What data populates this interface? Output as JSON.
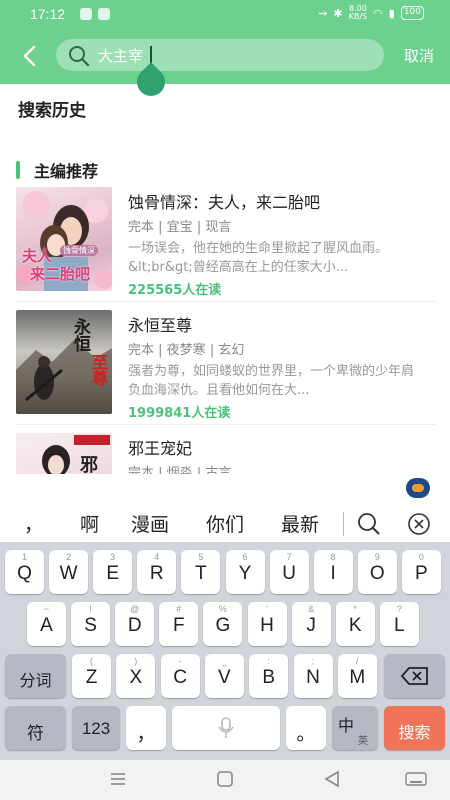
{
  "status": {
    "time": "17:12",
    "speed_top": "8.00",
    "speed_bottom": "KB/S",
    "battery": "100"
  },
  "search": {
    "value": "大主宰",
    "cancel": "取消"
  },
  "history_title": "搜索历史",
  "section_title": "主编推荐",
  "books": [
    {
      "title": "蚀骨情深：夫人，来二胎吧",
      "status": "完本",
      "author": "宜宝",
      "genre": "现言",
      "desc": "一场误会，他在她的生命里掀起了腥风血雨。&lt;br&gt;曾经高高在上的任家大小...",
      "reads": "225565人在读",
      "cover_main": "夫人",
      "cover_sub": "来二胎吧",
      "cover_tag": "蚀骨情深"
    },
    {
      "title": "永恒至尊",
      "status": "完本",
      "author": "夜梦寒",
      "genre": "玄幻",
      "desc": "强者为尊，如同蝼蚁的世界里，一个卑微的少年肩负血海深仇。且看他如何在大...",
      "reads": "1999841人在读",
      "cover_main": "永恒",
      "cover_sub": "至尊"
    },
    {
      "title": "邪王宠妃",
      "status": "完本",
      "author": "烟淼",
      "genre": "古言",
      "cover_main": "邪"
    }
  ],
  "candidates": [
    "，",
    "啊",
    "漫画",
    "你们",
    "最新"
  ],
  "keyboard": {
    "row1": [
      "Q",
      "W",
      "E",
      "R",
      "T",
      "Y",
      "U",
      "I",
      "O",
      "P"
    ],
    "row1_hints": [
      "1",
      "2",
      "3",
      "4",
      "5",
      "6",
      "7",
      "8",
      "9",
      "0"
    ],
    "row2": [
      "A",
      "S",
      "D",
      "F",
      "G",
      "H",
      "J",
      "K",
      "L"
    ],
    "row2_hints": [
      "~",
      "!",
      "@",
      "#",
      "%",
      "'",
      "&",
      "*",
      "?"
    ],
    "row3": [
      "Z",
      "X",
      "C",
      "V",
      "B",
      "N",
      "M"
    ],
    "row3_hints": [
      "(",
      ")",
      "-",
      "_",
      ":",
      ";",
      "/"
    ],
    "fenci": "分词",
    "fu": "符",
    "num": "123",
    "comma": "，",
    "period": "。",
    "zh": "中",
    "en": "英",
    "search": "搜索"
  },
  "colors": {
    "accent": "#6cd08f",
    "green_text": "#4cc17c",
    "search_key": "#f0745a"
  }
}
